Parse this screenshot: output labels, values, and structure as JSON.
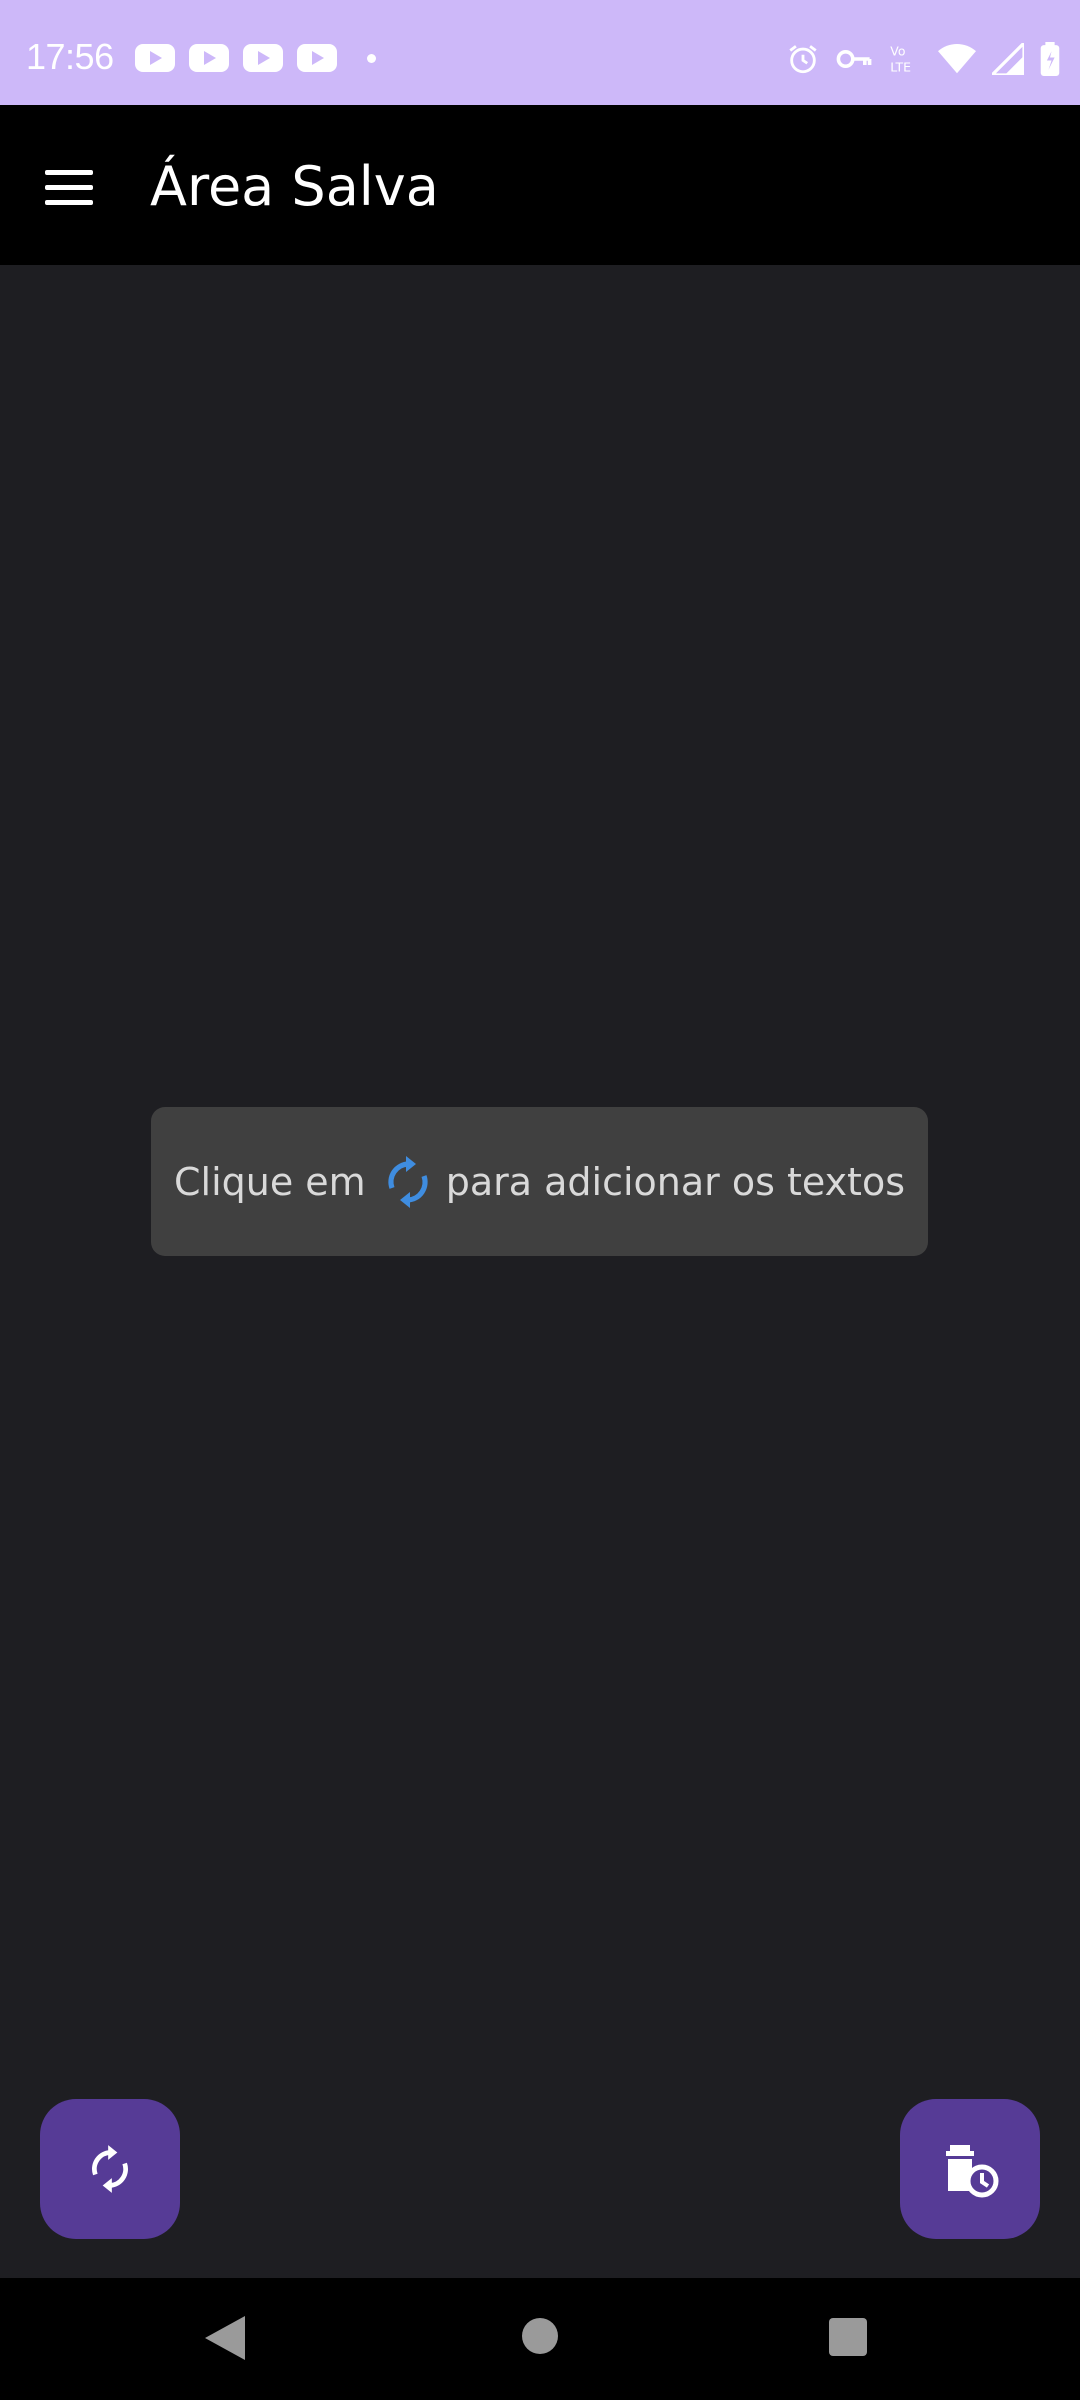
{
  "status_bar": {
    "time": "17:56",
    "notification_icons": [
      "youtube-icon",
      "youtube-icon",
      "youtube-icon",
      "youtube-icon",
      "dot"
    ],
    "system_icons": [
      "alarm-icon",
      "vpn-key-icon",
      "volte-icon",
      "wifi-icon",
      "signal-icon",
      "battery-icon"
    ],
    "volte_label": "Vo LTE"
  },
  "app_bar": {
    "title": "Área Salva",
    "menu_icon": "hamburger-menu-icon"
  },
  "hint": {
    "text_before": "Clique em",
    "icon": "refresh-icon",
    "text_after": "para adicionar os textos"
  },
  "fabs": {
    "refresh_icon": "refresh-icon",
    "clear_icon": "clipboard-delete-clock-icon"
  },
  "nav_bar": {
    "items": [
      "back-icon",
      "home-icon",
      "recents-icon"
    ]
  },
  "colors": {
    "status_bar_bg": "#cdb8f9",
    "app_bar_bg": "#000000",
    "content_bg": "#1e1e22",
    "toast_bg": "#404040",
    "fab_bg": "#563b96",
    "accent_blue": "#3f8de0"
  }
}
